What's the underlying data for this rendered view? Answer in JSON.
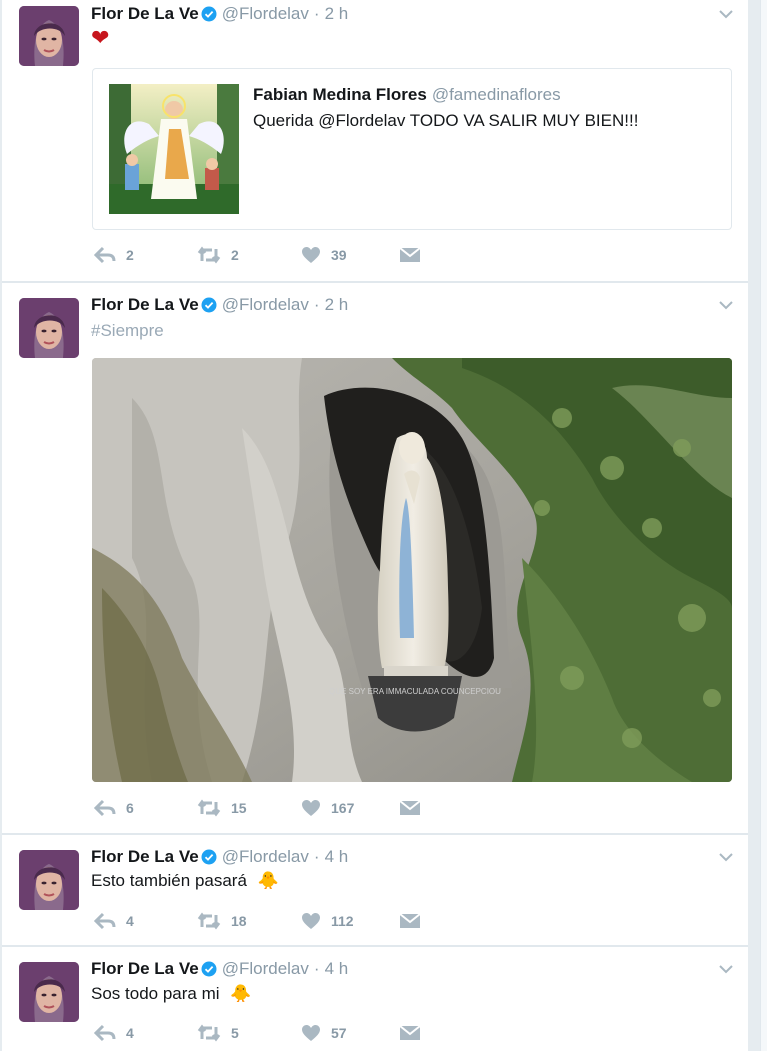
{
  "tweets": [
    {
      "name": "Flor De La Ve",
      "handle": "@Flordelav",
      "separator": "·",
      "time": "2 h",
      "text": "❤",
      "quote": {
        "name": "Fabian Medina Flores",
        "handle": "@famedinaflores",
        "text": "Querida @Flordelav TODO VA SALIR MUY BIEN!!!"
      },
      "actions": {
        "replies": "2",
        "retweets": "2",
        "likes": "39"
      }
    },
    {
      "name": "Flor De La Ve",
      "handle": "@Flordelav",
      "separator": "·",
      "time": "2 h",
      "text": "#Siempre",
      "actions": {
        "replies": "6",
        "retweets": "15",
        "likes": "167"
      }
    },
    {
      "name": "Flor De La Ve",
      "handle": "@Flordelav",
      "separator": "·",
      "time": "4 h",
      "text": "Esto también pasará",
      "emoji": "🐥",
      "actions": {
        "replies": "4",
        "retweets": "18",
        "likes": "112"
      }
    },
    {
      "name": "Flor De La Ve",
      "handle": "@Flordelav",
      "separator": "·",
      "time": "4 h",
      "text": "Sos todo para mi",
      "emoji": "🐥",
      "actions": {
        "replies": "4",
        "retweets": "5",
        "likes": "57"
      }
    }
  ],
  "media": {
    "plaque_text": "QUE SOY ERA IMMACULADA COUNCEPCIOU"
  },
  "icons": {
    "avatar": "avatar-photo",
    "verified": "verified-badge-icon",
    "caret": "chevron-down-icon",
    "reply": "reply-icon",
    "retweet": "retweet-icon",
    "like": "heart-icon",
    "dm": "envelope-icon"
  },
  "colors": {
    "verified": "#1da1f2",
    "icon_gray": "#aab8c2",
    "heart_red": "#c7161d"
  }
}
